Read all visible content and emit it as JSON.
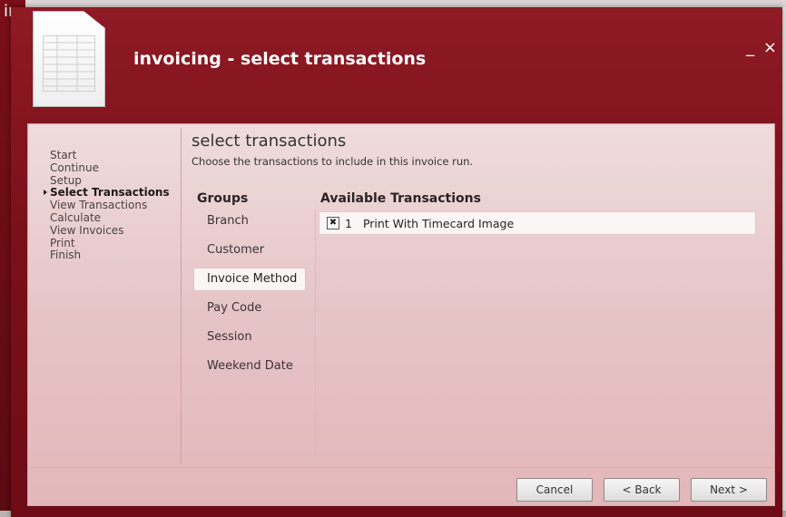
{
  "background_app": {
    "title_fragment": "ing"
  },
  "window": {
    "title": "invoicing - select transactions",
    "minimize_symbol": "_",
    "close_symbol": "×"
  },
  "steps": [
    {
      "label": "Start",
      "current": false
    },
    {
      "label": "Continue",
      "current": false
    },
    {
      "label": "Setup",
      "current": false
    },
    {
      "label": "Select Transactions",
      "current": true
    },
    {
      "label": "View Transactions",
      "current": false
    },
    {
      "label": "Calculate",
      "current": false
    },
    {
      "label": "View Invoices",
      "current": false
    },
    {
      "label": "Print",
      "current": false
    },
    {
      "label": "Finish",
      "current": false
    }
  ],
  "content": {
    "heading": "select transactions",
    "subtitle": "Choose the transactions to include in this invoice run.",
    "groups_title": "Groups",
    "groups": [
      "Branch",
      "Customer",
      "Invoice Method",
      "Pay Code",
      "Session",
      "Weekend Date"
    ],
    "selected_group": "Invoice Method",
    "available_title": "Available Transactions",
    "transactions": [
      {
        "checked": true,
        "check_mark": "✖",
        "number": "1",
        "label": "Print With Timecard Image"
      }
    ]
  },
  "buttons": {
    "cancel": "Cancel",
    "back": "< Back",
    "next": "Next >"
  },
  "colors": {
    "window_bg": "#7a1019",
    "panel_bg": "#e6c4c6",
    "selected_bg": "#fbf6f6"
  }
}
